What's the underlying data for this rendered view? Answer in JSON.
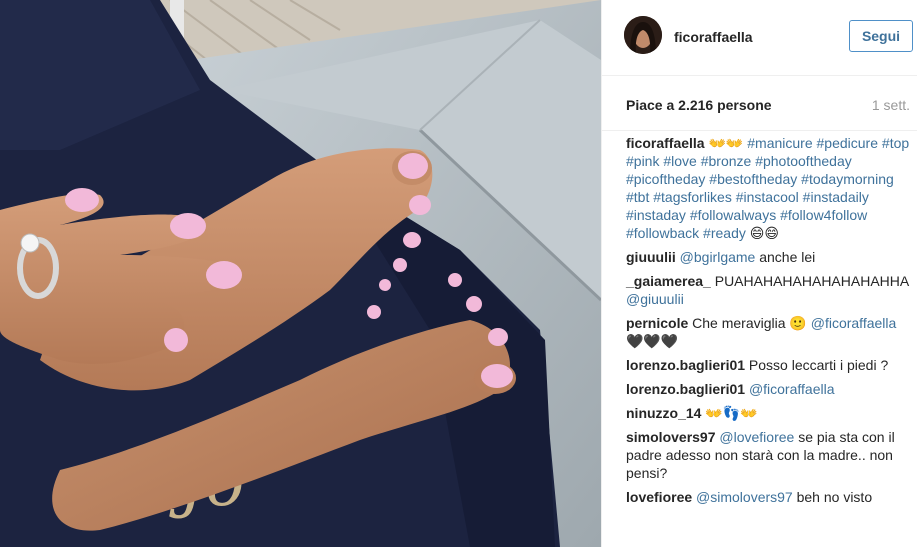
{
  "post": {
    "author": "ficoraffaella",
    "follow_label": "Segui",
    "likes_text": "Piace a 2.216 persone",
    "time_ago": "1 sett.",
    "photo_watermark": "Jo"
  },
  "caption": {
    "user": "ficoraffaella",
    "emoji": "👐👐",
    "hashtags": [
      "#manicure",
      "#pedicure",
      "#top",
      "#pink",
      "#love",
      "#bronze",
      "#photooftheday",
      "#picoftheday",
      "#bestoftheday",
      "#todaymorning",
      "#tbt",
      "#tagsforlikes",
      "#instacool",
      "#instadaily",
      "#instaday",
      "#followalways",
      "#follow4follow",
      "#followback",
      "#ready"
    ],
    "trailing_emoji": "😄😄"
  },
  "comments": [
    {
      "user": "giuuulii",
      "mention": "@bgirlgame",
      "text": " anche lei"
    },
    {
      "user": "_gaiamerea_",
      "mention": "",
      "text": " PUAHAHAHAHAHAHAHAHHA",
      "mention_after": "@giuuulii"
    },
    {
      "user": "pernicole",
      "mention": "",
      "text": " Che meraviglia 🙂",
      "mention_after": "@ficoraffaella",
      "after_text": " 🖤🖤🖤"
    },
    {
      "user": "lorenzo.baglieri01",
      "mention": "",
      "text": " Posso leccarti i piedi ?"
    },
    {
      "user": "lorenzo.baglieri01",
      "mention": "@ficoraffaella",
      "text": ""
    },
    {
      "user": "ninuzzo_14",
      "mention": "",
      "text": " 👐👣👐"
    },
    {
      "user": "simolovers97",
      "mention": "@lovefioree",
      "text": " se pia sta con il padre adesso non starà con la madre.. non pensi?"
    },
    {
      "user": "lovefioree",
      "mention": "@simolovers97",
      "text": " beh no visto"
    }
  ]
}
